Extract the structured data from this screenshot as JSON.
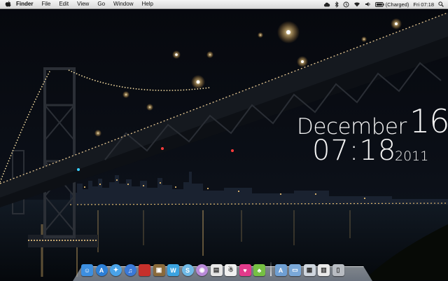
{
  "menubar": {
    "app_name": "Finder",
    "items": [
      "File",
      "Edit",
      "View",
      "Go",
      "Window",
      "Help"
    ],
    "battery_status": "(Charged)",
    "clock": "Fri 07:18"
  },
  "widget": {
    "month": "December",
    "day": "16",
    "time": "07:18",
    "year": "2011"
  },
  "dock": {
    "apps": [
      {
        "name": "finder-icon",
        "color": "#3d8fe0"
      },
      {
        "name": "app-store-icon",
        "color": "#2d7fd6"
      },
      {
        "name": "safari-icon",
        "color": "#4aa3e8"
      },
      {
        "name": "itunes-icon",
        "color": "#3a79d8"
      },
      {
        "name": "photo-booth-icon",
        "color": "#c6302b"
      },
      {
        "name": "iphoto-icon",
        "color": "#8a6a3a"
      },
      {
        "name": "messenger-icon",
        "color": "#3ba3e0"
      },
      {
        "name": "skype-icon",
        "color": "#6fb9e6"
      },
      {
        "name": "chat-bubble-icon",
        "color": "#b98ad8"
      },
      {
        "name": "preview-icon",
        "color": "#e6e6e6"
      },
      {
        "name": "monster-icon",
        "color": "#f0f0f0"
      },
      {
        "name": "heart-app-icon",
        "color": "#e23a8b"
      },
      {
        "name": "android-icon",
        "color": "#76c043"
      }
    ],
    "folders": [
      {
        "name": "applications-folder-icon",
        "color": "#6f9fd3"
      },
      {
        "name": "documents-folder-icon",
        "color": "#7aa8d8"
      },
      {
        "name": "downloads-stack-icon",
        "color": "#cfd6de"
      },
      {
        "name": "preview-doc-icon",
        "color": "#e9e9e9"
      },
      {
        "name": "trash-icon",
        "color": "#b8bcc2"
      }
    ]
  }
}
